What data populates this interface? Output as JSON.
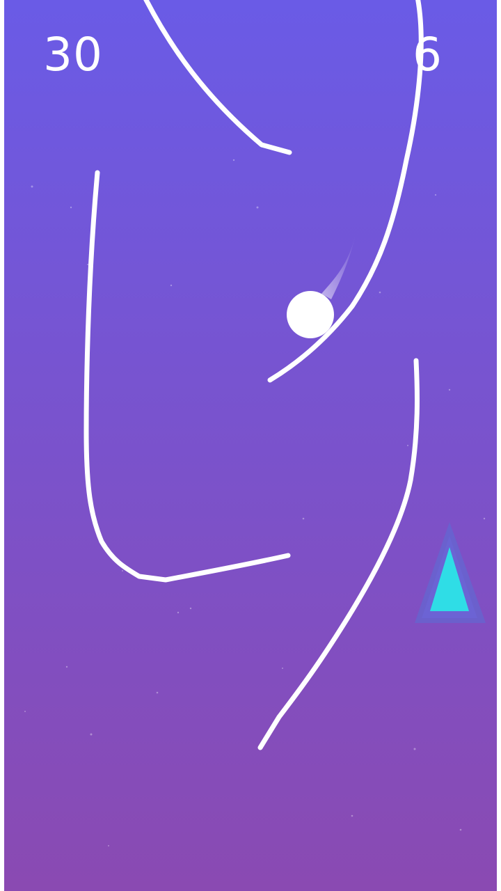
{
  "hud": {
    "score": "30",
    "level": "6"
  },
  "colors": {
    "background_top": "#6a5be6",
    "background_bottom": "#8a4ab2",
    "line": "#ffffff",
    "ball": "#ffffff",
    "goal_fill": "#2fdde6",
    "goal_outline": "#5a6fd6"
  },
  "icons": {
    "ball": "ball-icon",
    "goal": "triangle-goal-icon"
  }
}
